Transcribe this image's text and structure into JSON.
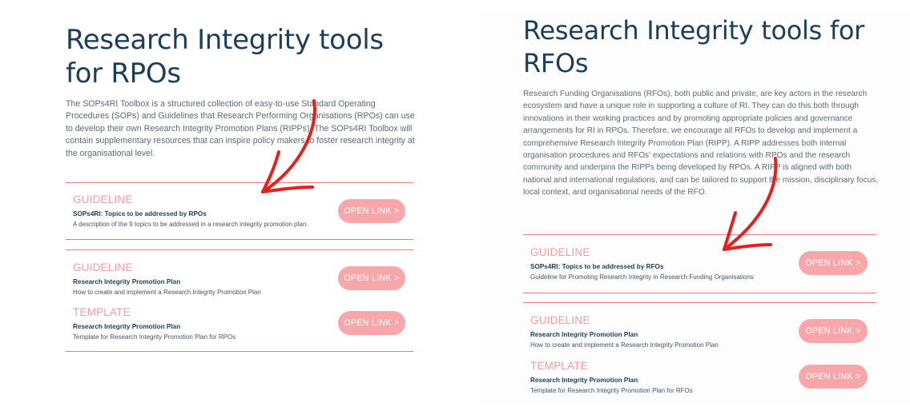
{
  "left": {
    "title": "Research Integrity tools for RPOs",
    "intro": "The SOPs4RI Toolbox is a structured collection of easy-to-use Standard Operating Procedures (SOPs) and Guidelines that Research Performing Organisations (RPOs) can use to develop their own Research Integrity Promotion Plans (RIPPs). The SOPs4RI Toolbox will contain supplementary resources that can inspire policy makers to foster research integrity at the organisational level.",
    "entries": [
      {
        "type": "GUIDELINE",
        "title": "SOPs4RI: Topics to be addressed by RPOs",
        "desc": "A description of the 9 topics to be addressed in a research integrity promotion plan.",
        "button": "OPEN LINK >"
      },
      {
        "type": "GUIDELINE",
        "title": "Research Integrity Promotion Plan",
        "desc": "How to create and implement a Research Integrity Promotion Plan",
        "button": "OPEN LINK >"
      },
      {
        "type": "TEMPLATE",
        "title": "Research Integrity Promotion Plan",
        "desc": "Template for Research Integrity Promotion Plan for RPOs",
        "button": "OPEN LINK >"
      }
    ]
  },
  "right": {
    "title": "Research Integrity tools for RFOs",
    "intro": "Research Funding Organisations (RFOs), both public and private, are key actors in the research ecosystem and have a unique role in supporting a culture of RI. They can do this both through innovations in their working practices and by promoting appropriate policies and governance arrangements for RI in RPOs. Therefore, we encourage all RFOs to develop and implement a comprehensive Research Integrity Promotion Plan (RIPP). A RIPP addresses both internal organisation procedures and RFOs' expectations and relations with RPOs and the research community and underpins the RIPPs being developed by RPOs. A RIPP is aligned with both national and international regulations, and can be tailored to support the mission, disciplinary focus, local context, and organisational needs of the RFO.",
    "entries": [
      {
        "type": "GUIDELINE",
        "title": "SOPs4RI: Topics to be addressed by RFOs",
        "desc": "Guideline for Promoting Research Integrity in Research Funding Organisations",
        "button": "OPEN LINK >"
      },
      {
        "type": "GUIDELINE",
        "title": "Research Integrity Promotion Plan",
        "desc": "How to create and implement a Research Integrity Promotion Plan",
        "button": "OPEN LINK >"
      },
      {
        "type": "TEMPLATE",
        "title": "Research Integrity Promotion Plan",
        "desc": "Template for Research Integrity Promotion Plan for RFOs",
        "button": "OPEN LINK >"
      }
    ]
  },
  "colors": {
    "title": "#1d3d5c",
    "accent": "#f29a9d",
    "button": "#f7a7aa",
    "divider": "#f07a7e",
    "arrow": "#e3201b"
  },
  "icons": [
    "hand-drawn-arrow-icon"
  ]
}
